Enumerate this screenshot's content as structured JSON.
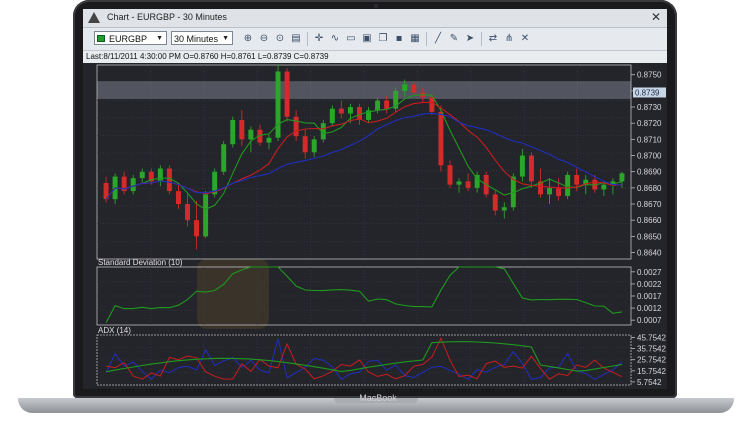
{
  "window": {
    "title": "Chart - EURGBP - 30 Minutes",
    "close_glyph": "✕"
  },
  "toolbar": {
    "symbol_value": "EURGBP",
    "timeframe_value": "30 Minutes",
    "icons": [
      "zoom-in-icon",
      "zoom-out-icon",
      "zoom-fit-icon",
      "chart-type-icon",
      "crosshair-icon",
      "indicator-icon",
      "template-icon",
      "print-icon",
      "copy-icon",
      "save-icon",
      "export-icon",
      "line-tool-icon",
      "draw-pen-icon",
      "arrow-tool-icon",
      "objects-icon",
      "fibonacci-icon",
      "settings-icon"
    ]
  },
  "info": {
    "ohlc_text": "Last:8/11/2011 4:30:00 PM O=0.8760 H=0.8761 L=0.8739 C=0.8739"
  },
  "colors": {
    "background": "#24242b",
    "bull": "#2aa62a",
    "bear": "#d42a2a",
    "ma_fast": "#1e9a1e",
    "ma_mid": "#c81e1e",
    "ma_slow": "#1f2fbf",
    "adx_plus": "#1f2fbf",
    "adx_minus": "#c81e1e",
    "adx_line": "#1e9a1e",
    "last_price_bg": "#c9d6e6"
  },
  "panes": {
    "price": {
      "ticks": [
        "0.8750",
        "0.8740",
        "0.8730",
        "0.8720",
        "0.8710",
        "0.8700",
        "0.8690",
        "0.8680",
        "0.8670",
        "0.8660",
        "0.8650",
        "0.8640"
      ],
      "last_price": "0.8739"
    },
    "stddev": {
      "label": "Standard Deviation (10)",
      "ticks": [
        "0.0027",
        "0.0022",
        "0.0017",
        "0.0012",
        "0.0007"
      ]
    },
    "adx": {
      "label": "ADX (14)",
      "ticks": [
        "45.7542",
        "35.7542",
        "25.7542",
        "15.7542",
        "5.7542"
      ]
    }
  },
  "chart_data": {
    "type": "candlestick",
    "title": "Chart - EURGBP - 30 Minutes",
    "ylim": [
      0.8636,
      0.8756
    ],
    "candles_approx": [
      [
        0.8683,
        0.8687,
        0.8671,
        0.8673
      ],
      [
        0.8673,
        0.8689,
        0.867,
        0.8687
      ],
      [
        0.8687,
        0.869,
        0.8676,
        0.8678
      ],
      [
        0.8678,
        0.8688,
        0.8676,
        0.8686
      ],
      [
        0.8686,
        0.8692,
        0.8683,
        0.869
      ],
      [
        0.869,
        0.8692,
        0.8682,
        0.8684
      ],
      [
        0.8684,
        0.8694,
        0.8681,
        0.8692
      ],
      [
        0.8692,
        0.8694,
        0.8676,
        0.8678
      ],
      [
        0.8678,
        0.8683,
        0.8667,
        0.867
      ],
      [
        0.867,
        0.8676,
        0.8656,
        0.866
      ],
      [
        0.866,
        0.8672,
        0.8642,
        0.865
      ],
      [
        0.865,
        0.8678,
        0.8649,
        0.8676
      ],
      [
        0.8676,
        0.8692,
        0.8674,
        0.869
      ],
      [
        0.869,
        0.8709,
        0.8688,
        0.8707
      ],
      [
        0.8707,
        0.8724,
        0.8705,
        0.8722
      ],
      [
        0.8722,
        0.8728,
        0.8706,
        0.871
      ],
      [
        0.871,
        0.8718,
        0.8702,
        0.8716
      ],
      [
        0.8716,
        0.8719,
        0.8706,
        0.8708
      ],
      [
        0.8708,
        0.8713,
        0.8704,
        0.8711
      ],
      [
        0.8711,
        0.8756,
        0.8709,
        0.8752
      ],
      [
        0.8752,
        0.8754,
        0.8721,
        0.8724
      ],
      [
        0.8724,
        0.8728,
        0.8709,
        0.8712
      ],
      [
        0.8712,
        0.8716,
        0.8698,
        0.8702
      ],
      [
        0.8702,
        0.8712,
        0.8699,
        0.871
      ],
      [
        0.871,
        0.8722,
        0.8708,
        0.872
      ],
      [
        0.872,
        0.8731,
        0.8718,
        0.8729
      ],
      [
        0.8729,
        0.8734,
        0.8723,
        0.8726
      ],
      [
        0.8726,
        0.8732,
        0.872,
        0.873
      ],
      [
        0.873,
        0.8732,
        0.8719,
        0.8722
      ],
      [
        0.8722,
        0.873,
        0.872,
        0.8728
      ],
      [
        0.8728,
        0.8736,
        0.8726,
        0.8734
      ],
      [
        0.8734,
        0.8737,
        0.8726,
        0.8729
      ],
      [
        0.8729,
        0.8742,
        0.8727,
        0.874
      ],
      [
        0.874,
        0.8747,
        0.8736,
        0.8744
      ],
      [
        0.8744,
        0.8746,
        0.8737,
        0.8739
      ],
      [
        0.8739,
        0.8742,
        0.8733,
        0.8736
      ],
      [
        0.8736,
        0.8738,
        0.8725,
        0.8727
      ],
      [
        0.8727,
        0.8731,
        0.869,
        0.8694
      ],
      [
        0.8694,
        0.8697,
        0.868,
        0.8682
      ],
      [
        0.8682,
        0.8686,
        0.8677,
        0.8684
      ],
      [
        0.8684,
        0.8689,
        0.8678,
        0.868
      ],
      [
        0.868,
        0.869,
        0.8677,
        0.8688
      ],
      [
        0.8688,
        0.869,
        0.8674,
        0.8676
      ],
      [
        0.8676,
        0.8679,
        0.8663,
        0.8666
      ],
      [
        0.8666,
        0.8671,
        0.8661,
        0.8668
      ],
      [
        0.8668,
        0.8689,
        0.8666,
        0.8687
      ],
      [
        0.8687,
        0.8704,
        0.8684,
        0.87
      ],
      [
        0.87,
        0.8702,
        0.868,
        0.8684
      ],
      [
        0.8684,
        0.8692,
        0.8674,
        0.8676
      ],
      [
        0.8676,
        0.8686,
        0.867,
        0.868
      ],
      [
        0.868,
        0.8686,
        0.8672,
        0.8675
      ],
      [
        0.8675,
        0.869,
        0.8673,
        0.8688
      ],
      [
        0.8688,
        0.8692,
        0.8678,
        0.8682
      ],
      [
        0.8682,
        0.8688,
        0.8676,
        0.8685
      ],
      [
        0.8685,
        0.8688,
        0.8677,
        0.8679
      ],
      [
        0.8679,
        0.8684,
        0.8675,
        0.8682
      ],
      [
        0.8682,
        0.8686,
        0.8676,
        0.8684
      ],
      [
        0.8684,
        0.869,
        0.868,
        0.8689
      ]
    ]
  }
}
